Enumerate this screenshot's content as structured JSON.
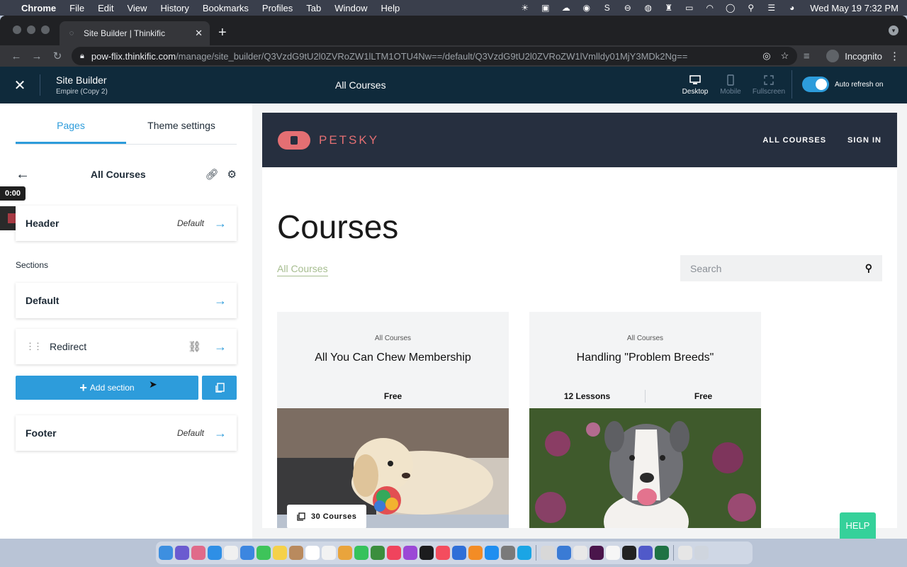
{
  "menubar": {
    "app": "Chrome",
    "items": [
      "File",
      "Edit",
      "View",
      "History",
      "Bookmarks",
      "Profiles",
      "Tab",
      "Window",
      "Help"
    ],
    "clock": "Wed May 19  7:32 PM"
  },
  "browser": {
    "tab_title": "Site Builder | Thinkific",
    "url_host": "pow-flix.thinkific.com",
    "url_path": "/manage/site_builder/Q3VzdG9tU2l0ZVRoZW1lLTM1OTU4Nw==/default/Q3VzdG9tU2l0ZVRoZW1lVmlldy01MjY3MDk2Ng==",
    "profile": "Incognito"
  },
  "builder": {
    "title": "Site Builder",
    "theme": "Empire (Copy 2)",
    "page_title": "All Courses",
    "views": [
      "Desktop",
      "Mobile",
      "Fullscreen"
    ],
    "toggle_label": "Auto refresh on"
  },
  "panel": {
    "tabs": [
      "Pages",
      "Theme settings"
    ],
    "page_name": "All Courses",
    "timer": "0:00",
    "header": {
      "label": "Header",
      "tag": "Default"
    },
    "sections_label": "Sections",
    "sections": [
      {
        "label": "Default"
      },
      {
        "label": "Redirect"
      }
    ],
    "add_section": "Add section",
    "footer": {
      "label": "Footer",
      "tag": "Default"
    }
  },
  "site": {
    "logo_text": "PETSKY",
    "nav": [
      "ALL COURSES",
      "SIGN IN"
    ],
    "heading": "Courses",
    "filter": "All Courses",
    "search_placeholder": "Search",
    "courses": [
      {
        "category": "All Courses",
        "name": "All You Can Chew Membership",
        "price": "Free",
        "badge": "30 Courses"
      },
      {
        "category": "All Courses",
        "name": "Handling \"Problem Breeds\"",
        "lessons": "12 Lessons",
        "price": "Free"
      }
    ],
    "help": "HELP"
  },
  "colors": {
    "accent": "#2d9cdb",
    "topbar": "#0f2a3b",
    "site_nav": "#262f3f",
    "logo": "#e46f73",
    "filter": "#a6bd8f",
    "help": "#35d19a"
  }
}
